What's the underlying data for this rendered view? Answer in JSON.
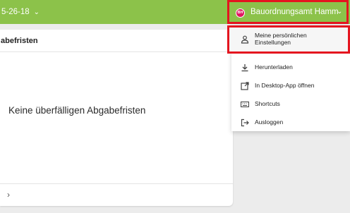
{
  "header": {
    "project_title": "5-26-18",
    "user_initials": "BH",
    "user_name": "Bauordnungsamt Hamm"
  },
  "card": {
    "title": "abefristen",
    "empty_message": "Keine überfälligen Abgabefristen"
  },
  "user_menu": {
    "items": [
      {
        "label_line1": "Meine persönlichen",
        "label_line2": "Einstellungen",
        "icon": "person-icon"
      },
      {
        "label": "Herunterladen",
        "icon": "download-icon"
      },
      {
        "label": "In Desktop-App öffnen",
        "icon": "open-external-icon"
      },
      {
        "label": "Shortcuts",
        "icon": "keyboard-icon"
      },
      {
        "label": "Ausloggen",
        "icon": "logout-icon"
      }
    ]
  },
  "colors": {
    "topbar": "#8cc24a",
    "avatar": "#e0165f",
    "highlight_border": "#e4151f"
  }
}
